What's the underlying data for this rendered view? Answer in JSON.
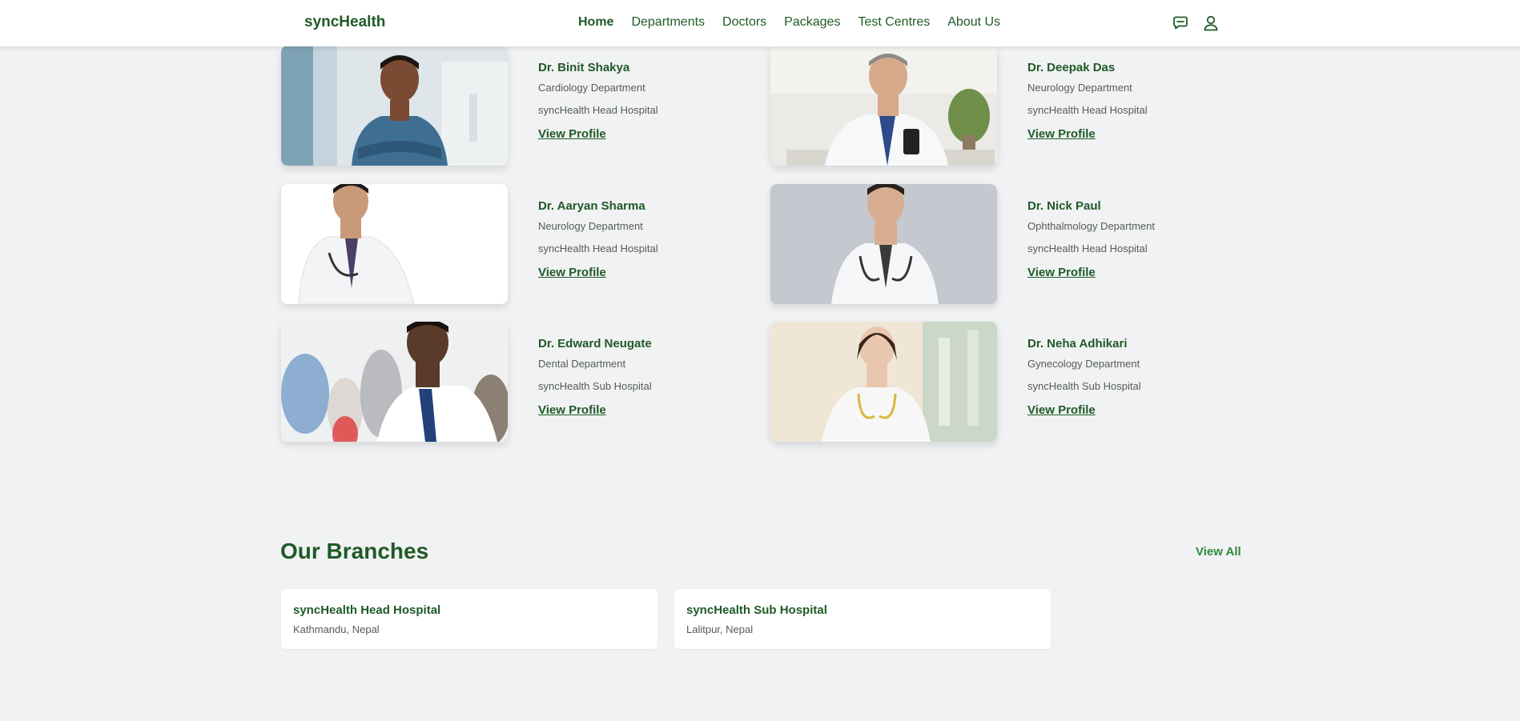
{
  "header": {
    "brand": "syncHealth",
    "nav": [
      "Home",
      "Departments",
      "Doctors",
      "Packages",
      "Test Centres",
      "About Us"
    ],
    "active_nav": "Home",
    "icons": [
      "chat-icon",
      "user-icon"
    ]
  },
  "doctors": [
    {
      "name": "Dr. Binit Shakya",
      "department": "Cardiology Department",
      "hospital": "syncHealth Head Hospital",
      "link": "View Profile"
    },
    {
      "name": "Dr. Deepak Das",
      "department": "Neurology Department",
      "hospital": "syncHealth Head Hospital",
      "link": "View Profile"
    },
    {
      "name": "Dr. Aaryan Sharma",
      "department": "Neurology Department",
      "hospital": "syncHealth Head Hospital",
      "link": "View Profile"
    },
    {
      "name": "Dr. Nick Paul",
      "department": "Ophthalmology Department",
      "hospital": "syncHealth Head Hospital",
      "link": "View Profile"
    },
    {
      "name": "Dr. Edward Neugate",
      "department": "Dental Department",
      "hospital": "syncHealth Sub Hospital",
      "link": "View Profile"
    },
    {
      "name": "Dr. Neha Adhikari",
      "department": "Gynecology Department",
      "hospital": "syncHealth Sub Hospital",
      "link": "View Profile"
    }
  ],
  "branches_section": {
    "title": "Our Branches",
    "view_all": "View All",
    "items": [
      {
        "name": "syncHealth Head Hospital",
        "location": "Kathmandu, Nepal"
      },
      {
        "name": "syncHealth Sub Hospital",
        "location": "Lalitpur, Nepal"
      }
    ]
  },
  "colors": {
    "accent": "#1f5a26",
    "link": "#2f8a3a",
    "background": "#f1f2f4"
  }
}
